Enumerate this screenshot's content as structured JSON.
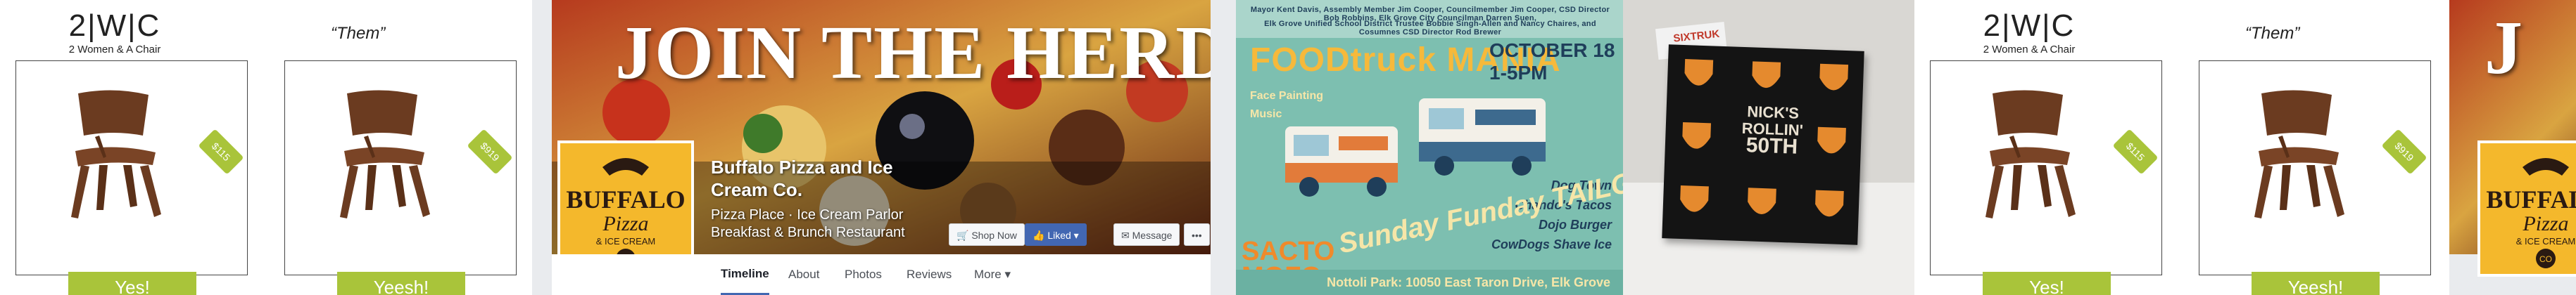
{
  "strip_1": {
    "logo_mark": "2|W|C",
    "logo_sub": "2 Women & A Chair",
    "them_label": "“Them”",
    "card_left": {
      "button": "Yes!",
      "price_tag": "$115"
    },
    "card_right": {
      "button": "Yeesh!",
      "price_tag": "$919"
    }
  },
  "fb_page": {
    "cover_headline": "JOIN THE HERD",
    "logo_lines": [
      "BUFFALO",
      "Pizza",
      "& ICE CREAM",
      "CO"
    ],
    "page_name": "Buffalo Pizza and Ice Cream Co.",
    "category_line1": "Pizza Place · Ice Cream Parlor",
    "category_line2": "Breakfast & Brunch Restaurant",
    "actions": {
      "shop": "Shop Now",
      "liked": "Liked ▾",
      "message": "Message",
      "more": "•••"
    },
    "tabs": [
      "Timeline",
      "About",
      "Photos",
      "Reviews",
      "More ▾"
    ]
  },
  "food_truck": {
    "top_line_1": "Mayor Kent Davis, Assembly Member Jim Cooper, Councilmember Jim Cooper, CSD Director Bob Robbins, Elk Grove City Councilman Darren Suen,",
    "top_line_2": "Elk Grove Unified School District Trustee Bobbie Singh-Allen and Nancy Chaires, and Cosumnes CSD Director Rod Brewer",
    "title": "FOODtruck MANIA",
    "date": "OCTOBER 18   1-5PM",
    "side_1": "Face Painting",
    "side_2": "Music",
    "menu": [
      "Dog Town",
      "Chando's Tacos",
      "Dojo Burger",
      "CowDogs Shave Ice"
    ],
    "sunday": "Sunday Funday TAILGATE Party",
    "sacto": [
      "SACTO",
      "MOFO"
    ],
    "footer": "Nottoli Park: 10050 East Taron Drive, Elk Grove"
  },
  "stones_photo": {
    "box_brand": "SIXTRUK",
    "card_line1": "NICK'S",
    "card_line2": "ROLLIN'",
    "card_line3": "50TH"
  },
  "colors": {
    "green": "#a9c43a",
    "fb_blue": "#4267b2",
    "buffalo_yellow": "#f4b82c",
    "teal": "#7dbfb0",
    "orange": "#f08a2b"
  }
}
